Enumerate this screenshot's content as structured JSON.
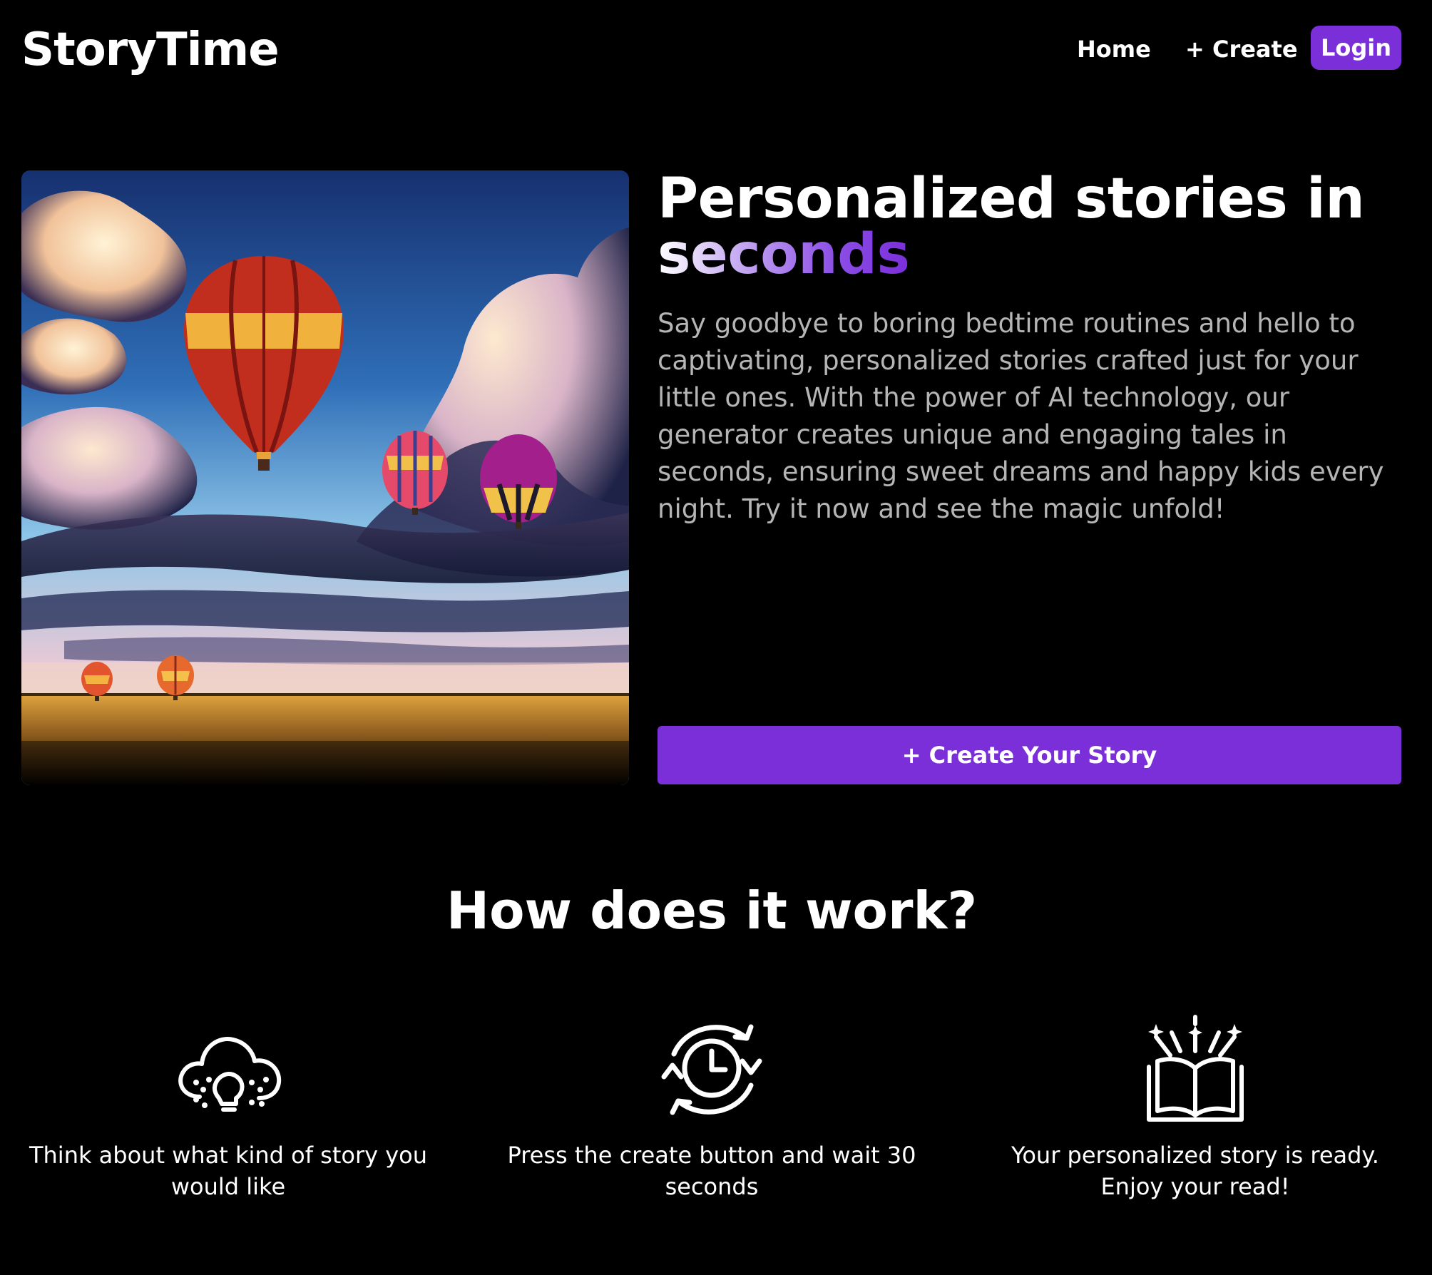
{
  "header": {
    "brand": "StoryTime",
    "nav": {
      "home": "Home",
      "create": "+ Create",
      "login": "Login"
    }
  },
  "hero": {
    "headline_line1": "Personalized stories in",
    "headline_line2": "seconds",
    "description": "Say goodbye to boring bedtime routines and hello to captivating, personalized stories crafted just for your little ones. With the power of AI technology, our generator creates unique and engaging tales in seconds, ensuring sweet dreams and happy kids every night. Try it now and see the magic unfold!",
    "cta": "+ Create Your Story",
    "image_icon": "hot-air-balloons-illustration"
  },
  "how_it_works": {
    "title": "How does it work?",
    "steps": [
      {
        "icon": "cloud-lightbulb-icon",
        "text": "Think about what kind of story you would like"
      },
      {
        "icon": "clock-refresh-icon",
        "text": "Press the create button and wait 30 seconds"
      },
      {
        "icon": "open-book-sparkle-icon",
        "text": "Your personalized story is ready. Enjoy your read!"
      }
    ]
  },
  "colors": {
    "background": "#000000",
    "accent": "#7a2fd9",
    "text": "#ffffff",
    "muted_text": "#b5b5b5"
  }
}
